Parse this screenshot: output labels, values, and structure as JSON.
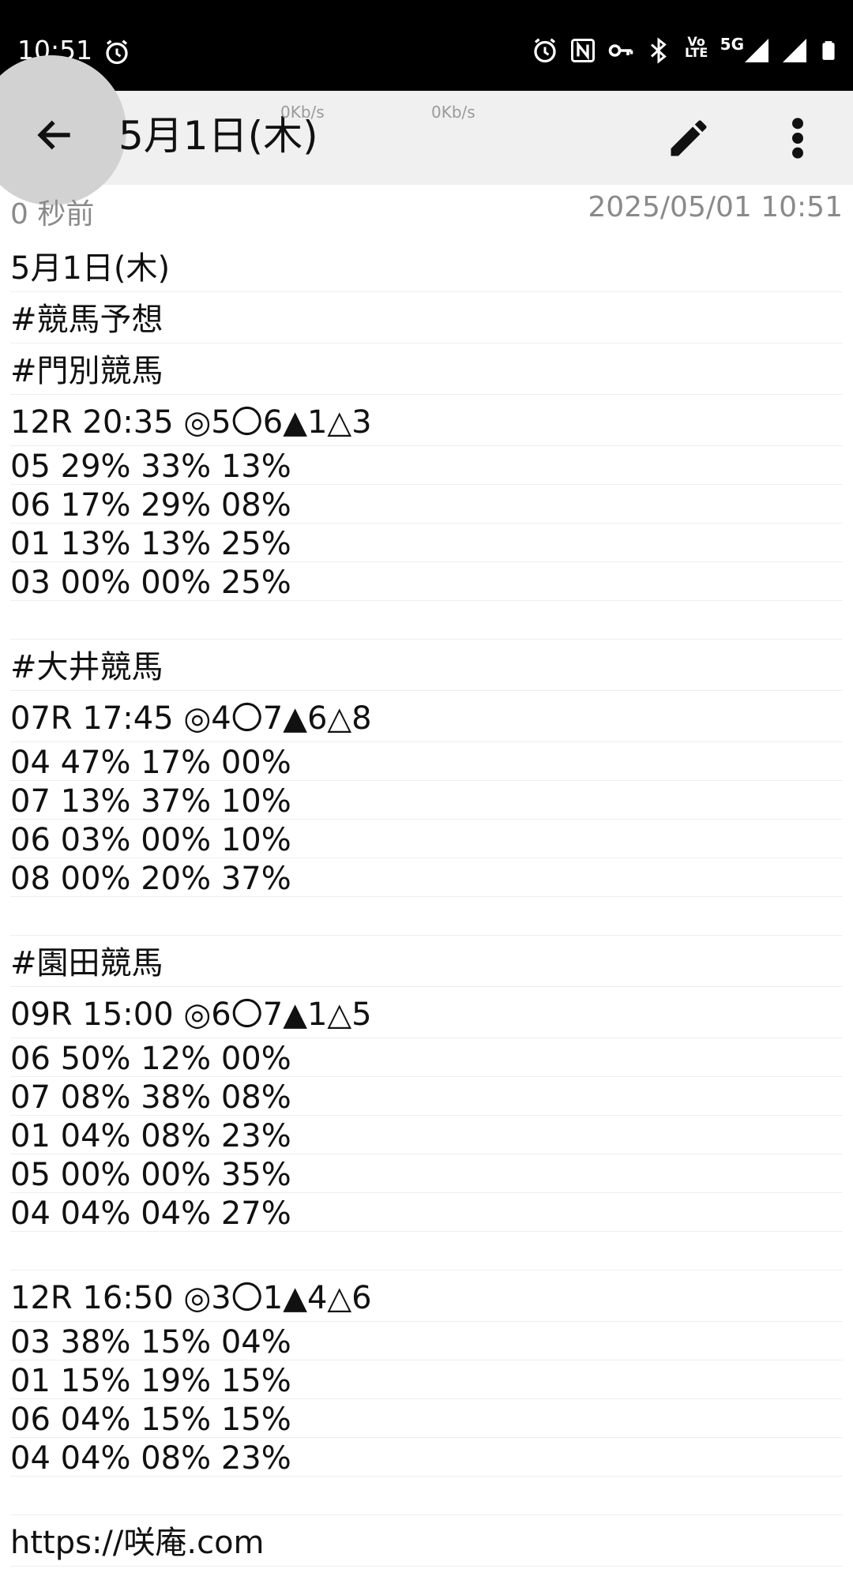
{
  "status_bar": {
    "time": "10:51",
    "icons": [
      "alarm-icon",
      "alarm-icon",
      "nfc-icon",
      "vpn-key-icon",
      "bluetooth-icon",
      "volte-icon",
      "signal-5g-icon",
      "signal-icon",
      "battery-icon"
    ],
    "volte_top": "Vo",
    "volte_bottom": "LTE",
    "network": "5G"
  },
  "app_bar": {
    "title": "5月1日(木)",
    "speed_left": "0Kb/s",
    "speed_right": "0Kb/s",
    "icons": [
      "back-arrow-icon",
      "edit-pencil-icon",
      "more-vert-icon"
    ]
  },
  "meta": {
    "relative_time": "0 秒前",
    "timestamp": "2025/05/01 10:51"
  },
  "note": {
    "lines": [
      {
        "text": "5月1日(木)",
        "kind": "head"
      },
      {
        "text": "#競馬予想",
        "kind": "head"
      },
      {
        "text": "#門別競馬",
        "kind": "head"
      },
      {
        "text": "12R 20:35 ◎5〇6▲1△3",
        "kind": "head"
      },
      {
        "text": "05 29% 33% 13%",
        "kind": "data"
      },
      {
        "text": "06 17% 29% 08%",
        "kind": "data"
      },
      {
        "text": "01 13% 13% 25%",
        "kind": "data"
      },
      {
        "text": "03 00% 00% 25%",
        "kind": "data"
      },
      {
        "text": "",
        "kind": "blank"
      },
      {
        "text": "#大井競馬",
        "kind": "head"
      },
      {
        "text": "07R 17:45 ◎4〇7▲6△8",
        "kind": "head"
      },
      {
        "text": "04 47% 17% 00%",
        "kind": "data"
      },
      {
        "text": "07 13% 37% 10%",
        "kind": "data"
      },
      {
        "text": "06 03% 00% 10%",
        "kind": "data"
      },
      {
        "text": "08 00% 20% 37%",
        "kind": "data"
      },
      {
        "text": "",
        "kind": "blank"
      },
      {
        "text": "#園田競馬",
        "kind": "head"
      },
      {
        "text": "09R 15:00 ◎6〇7▲1△5",
        "kind": "head"
      },
      {
        "text": "06 50% 12% 00%",
        "kind": "data"
      },
      {
        "text": "07 08% 38% 08%",
        "kind": "data"
      },
      {
        "text": "01 04% 08% 23%",
        "kind": "data"
      },
      {
        "text": "05 00% 00% 35%",
        "kind": "data"
      },
      {
        "text": "04 04% 04% 27%",
        "kind": "data"
      },
      {
        "text": "",
        "kind": "blank"
      },
      {
        "text": "12R 16:50 ◎3〇1▲4△6",
        "kind": "head"
      },
      {
        "text": "03 38% 15% 04%",
        "kind": "data"
      },
      {
        "text": "01 15% 19% 15%",
        "kind": "data"
      },
      {
        "text": "06 04% 15% 15%",
        "kind": "data"
      },
      {
        "text": "04 04% 08% 23%",
        "kind": "data"
      },
      {
        "text": "",
        "kind": "blank"
      },
      {
        "text": "https://咲庵.com",
        "kind": "head"
      }
    ]
  }
}
